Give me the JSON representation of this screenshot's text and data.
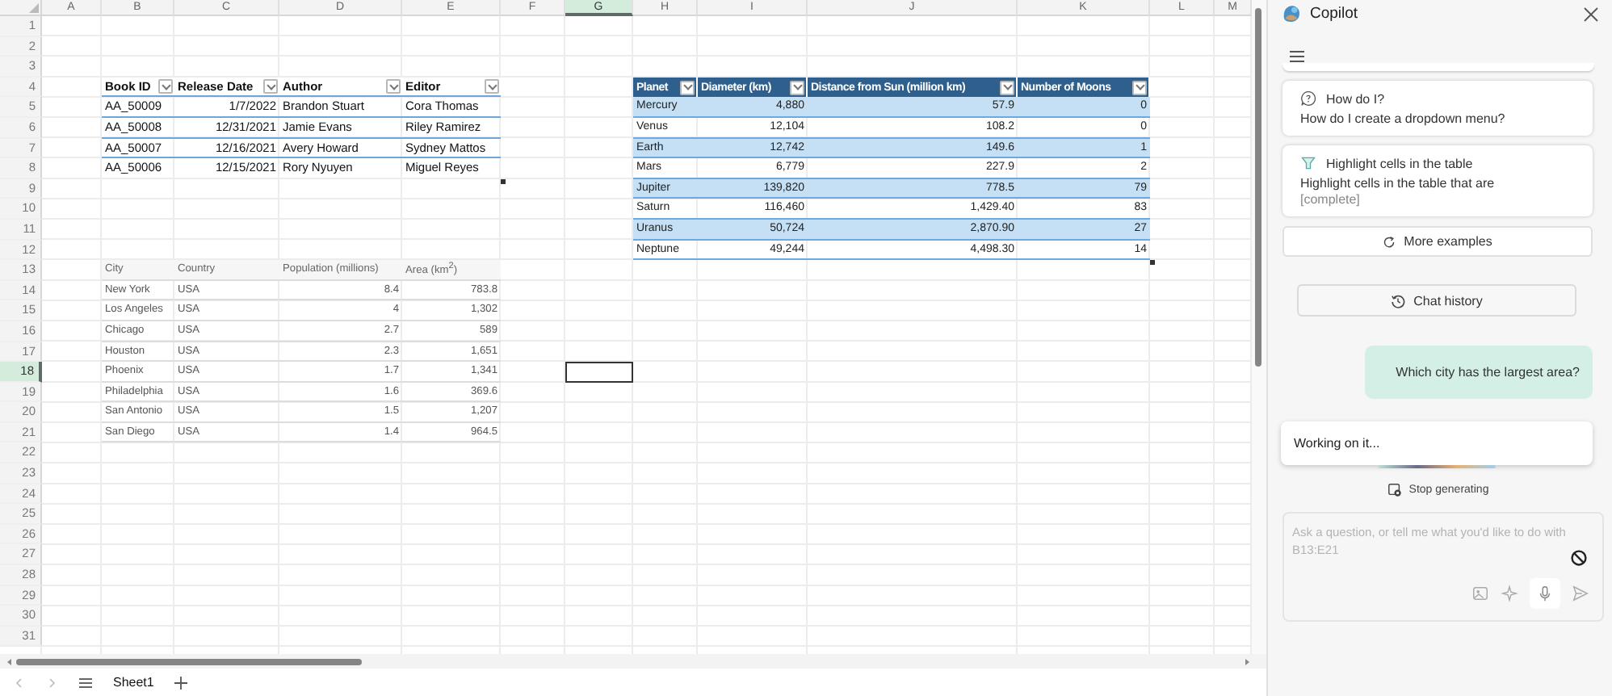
{
  "sheet": {
    "columns": [
      {
        "label": "A",
        "selected": false
      },
      {
        "label": "B",
        "selected": false
      },
      {
        "label": "C",
        "selected": false
      },
      {
        "label": "D",
        "selected": false
      },
      {
        "label": "E",
        "selected": false
      },
      {
        "label": "F",
        "selected": false
      },
      {
        "label": "G",
        "selected": true
      },
      {
        "label": "H",
        "selected": false
      },
      {
        "label": "I",
        "selected": false
      },
      {
        "label": "J",
        "selected": false
      },
      {
        "label": "K",
        "selected": false
      },
      {
        "label": "L",
        "selected": false
      },
      {
        "label": "M",
        "selected": false
      }
    ],
    "rows": [
      {
        "label": "1",
        "selected": false
      },
      {
        "label": "2",
        "selected": false
      },
      {
        "label": "3",
        "selected": false
      },
      {
        "label": "4",
        "selected": false
      },
      {
        "label": "5",
        "selected": false
      },
      {
        "label": "6",
        "selected": false
      },
      {
        "label": "7",
        "selected": false
      },
      {
        "label": "8",
        "selected": false
      },
      {
        "label": "9",
        "selected": false
      },
      {
        "label": "10",
        "selected": false
      },
      {
        "label": "11",
        "selected": false
      },
      {
        "label": "12",
        "selected": false
      },
      {
        "label": "13",
        "selected": false
      },
      {
        "label": "14",
        "selected": false
      },
      {
        "label": "15",
        "selected": false
      },
      {
        "label": "16",
        "selected": false
      },
      {
        "label": "17",
        "selected": false
      },
      {
        "label": "18",
        "selected": true
      },
      {
        "label": "19",
        "selected": false
      },
      {
        "label": "20",
        "selected": false
      },
      {
        "label": "21",
        "selected": false
      },
      {
        "label": "22",
        "selected": false
      },
      {
        "label": "23",
        "selected": false
      },
      {
        "label": "24",
        "selected": false
      },
      {
        "label": "25",
        "selected": false
      },
      {
        "label": "26",
        "selected": false
      },
      {
        "label": "27",
        "selected": false
      },
      {
        "label": "28",
        "selected": false
      },
      {
        "label": "29",
        "selected": false
      },
      {
        "label": "30",
        "selected": false
      },
      {
        "label": "31",
        "selected": false
      }
    ],
    "tables": [
      {
        "kind": "filtered",
        "columns": [
          {
            "label": "Book ID",
            "numeric": false
          },
          {
            "label": "Release Date",
            "numeric": true
          },
          {
            "label": "Author",
            "numeric": false
          },
          {
            "label": "Editor",
            "numeric": false
          }
        ],
        "rows": [
          [
            "AA_50009",
            "1/7/2022",
            "Brandon Stuart",
            "Cora Thomas"
          ],
          [
            "AA_50008",
            "12/31/2021",
            "Jamie Evans",
            "Riley Ramirez"
          ],
          [
            "AA_50007",
            "12/16/2021",
            "Avery Howard",
            "Sydney Mattos"
          ],
          [
            "AA_50006",
            "12/15/2021",
            "Rory Nyuyen",
            "Miguel Reyes"
          ]
        ]
      },
      {
        "kind": "banded",
        "columns": [
          {
            "label": "Planet",
            "numeric": false
          },
          {
            "label": "Diameter (km)",
            "numeric": true
          },
          {
            "label": "Distance from Sun (million km)",
            "numeric": true
          },
          {
            "label": "Number of Moons",
            "numeric": true
          }
        ],
        "rows": [
          [
            "Mercury",
            "4,880",
            "57.9",
            "0"
          ],
          [
            "Venus",
            "12,104",
            "108.2",
            "0"
          ],
          [
            "Earth",
            "12,742",
            "149.6",
            "1"
          ],
          [
            "Mars",
            "6,779",
            "227.9",
            "2"
          ],
          [
            "Jupiter",
            "139,820",
            "778.5",
            "79"
          ],
          [
            "Saturn",
            "116,460",
            "1,429.40",
            "83"
          ],
          [
            "Uranus",
            "50,724",
            "2,870.90",
            "27"
          ],
          [
            "Neptune",
            "49,244",
            "4,498.30",
            "14"
          ]
        ]
      },
      {
        "kind": "plain",
        "columns": [
          {
            "label": "City",
            "numeric": false
          },
          {
            "label": "Country",
            "numeric": false
          },
          {
            "label": "Population (millions)",
            "numeric": true
          },
          {
            "label": "Area (km$^{2}$)",
            "numeric": true
          }
        ],
        "rows": [
          [
            "New York",
            "USA",
            "8.4",
            "783.8"
          ],
          [
            "Los Angeles",
            "USA",
            "4",
            "1,302"
          ],
          [
            "Chicago",
            "USA",
            "2.7",
            "589"
          ],
          [
            "Houston",
            "USA",
            "2.3",
            "1,651"
          ],
          [
            "Phoenix",
            "USA",
            "1.7",
            "1,341"
          ],
          [
            "Philadelphia",
            "USA",
            "1.6",
            "369.6"
          ],
          [
            "San Antonio",
            "USA",
            "1.5",
            "1,207"
          ],
          [
            "San Diego",
            "USA",
            "1.4",
            "964.5"
          ]
        ]
      }
    ]
  },
  "sheet_tabs": [
    {
      "label": "Sheet1",
      "selected": true
    }
  ],
  "copilot": {
    "title": "Copilot",
    "prompt_cards": [
      {
        "kind": "question",
        "title": "How do I?",
        "text": "How do I create a dropdown menu?"
      },
      {
        "kind": "highlight",
        "title": "Highlight cells in the table",
        "text": "Highlight cells in the table that are",
        "hint": "[complete]"
      }
    ],
    "more_examples": "More examples",
    "chat_history": "Chat history",
    "messages": [
      {
        "kind": "user",
        "text": "Which city has the largest area?"
      },
      {
        "kind": "bot",
        "text": "Working on it..."
      }
    ],
    "stop": "Stop generating",
    "input": {
      "placeholder": "Ask a question, or tell me what you'd like to do with B13:E21"
    }
  }
}
